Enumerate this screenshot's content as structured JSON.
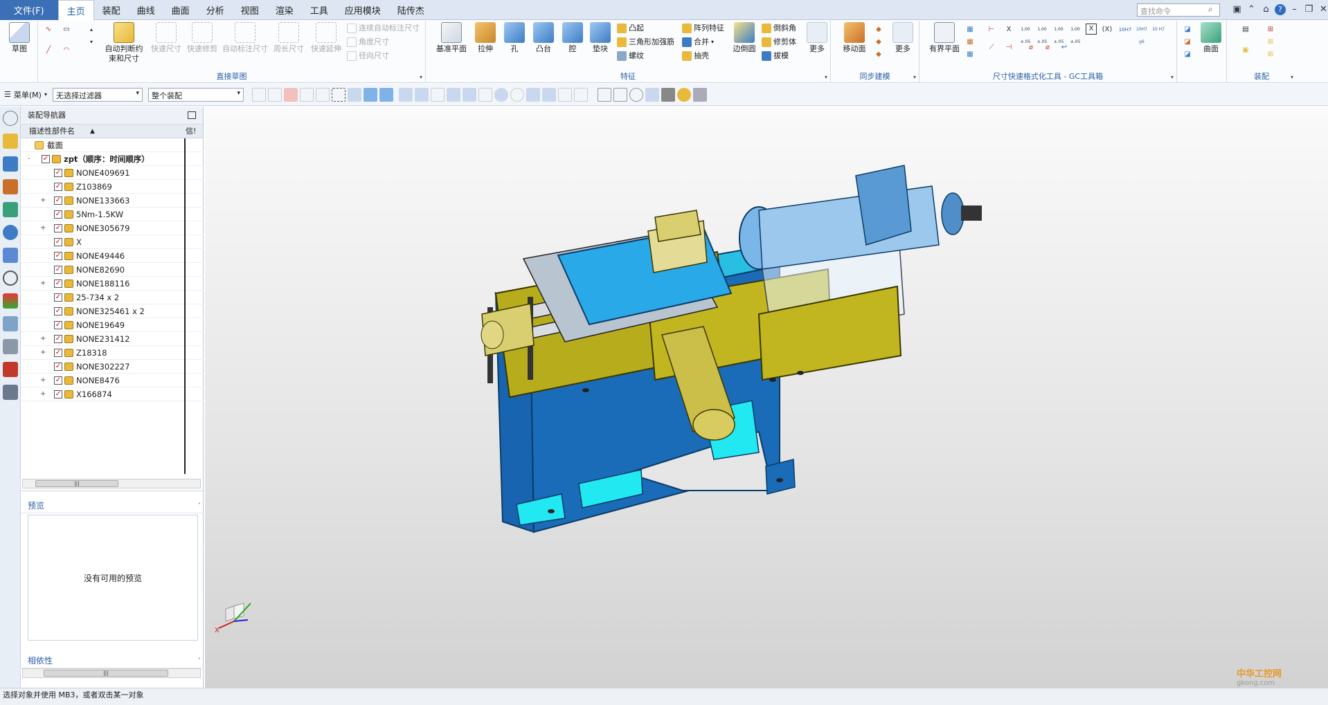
{
  "tabs": {
    "file": "文件(F)",
    "items": [
      "主页",
      "装配",
      "曲线",
      "曲面",
      "分析",
      "视图",
      "渲染",
      "工具",
      "应用模块",
      "陆传杰"
    ]
  },
  "search_placeholder": "查找命令",
  "ribbon": {
    "sketch": {
      "label": "草图"
    },
    "direct_sketch": {
      "group_label": "直接草图",
      "auto_constraint": "自动判断约束和尺寸",
      "quick_dim": "快速尺寸",
      "quick_trim": "快速修剪",
      "auto_dim": "自动标注尺寸",
      "perimeter_dim": "周长尺寸",
      "quick_extend": "快速延伸",
      "cont_auto_dim": "连续自动标注尺寸",
      "angle_dim": "角度尺寸",
      "radial_dim": "径向尺寸"
    },
    "feature": {
      "group_label": "特征",
      "datum_plane": "基准平面",
      "extrude": "拉伸",
      "hole": "孔",
      "boss": "凸台",
      "pocket": "腔",
      "pad": "垫块",
      "emboss": "凸起",
      "tri_rib": "三角形加强筋",
      "thread": "螺纹",
      "pattern": "阵列特征",
      "unite": "合并",
      "shell": "抽壳",
      "edge_blend": "边倒圆",
      "chamfer": "倒斜角",
      "trim_body": "修剪体",
      "draft": "拔模",
      "more": "更多"
    },
    "sync": {
      "group_label": "同步建模",
      "move_face": "移动面",
      "more": "更多"
    },
    "gc": {
      "group_label": "尺寸快速格式化工具 - GC工具箱",
      "bounded_plane": "有界平面",
      "x_label": "X",
      "x_paren": "(X)",
      "fmt_1": "1.00 ±.05",
      "fmt_2": "1.00 ±.05",
      "fmt_3": "1.00 ±.05",
      "fmt_4": "1.00 ±.05",
      "fit_1": "10H7",
      "fit_2": "10H7 g6",
      "fit_3": "10 H7"
    },
    "surface": {
      "label": "曲面"
    },
    "assembly": {
      "group_label": "装配"
    }
  },
  "toolbar": {
    "menu": "菜单(M)",
    "filter": "无选择过滤器",
    "scope": "整个装配"
  },
  "navigator": {
    "title": "装配导航器",
    "col_name": "描述性部件名",
    "col_info": "信!",
    "rows": [
      {
        "label": "截面",
        "type": "folder"
      },
      {
        "label": "zpt（顺序：时间顺序）",
        "type": "root",
        "expand": "-"
      },
      {
        "label": "NONE409691",
        "expand": ""
      },
      {
        "label": "Z103869",
        "expand": ""
      },
      {
        "label": "NONE133663",
        "expand": "+"
      },
      {
        "label": "5Nm-1.5KW",
        "expand": ""
      },
      {
        "label": "NONE305679",
        "expand": "+"
      },
      {
        "label": "X",
        "expand": ""
      },
      {
        "label": "NONE49446",
        "expand": ""
      },
      {
        "label": "NONE82690",
        "expand": ""
      },
      {
        "label": "NONE188116",
        "expand": "+"
      },
      {
        "label": "25-734 x 2",
        "expand": ""
      },
      {
        "label": "NONE325461 x 2",
        "expand": ""
      },
      {
        "label": "NONE19649",
        "expand": ""
      },
      {
        "label": "NONE231412",
        "expand": "+"
      },
      {
        "label": "Z18318",
        "expand": "+"
      },
      {
        "label": "NONE302227",
        "expand": ""
      },
      {
        "label": "NONE8476",
        "expand": "+"
      },
      {
        "label": "X166874",
        "expand": "+"
      }
    ],
    "preview_title": "预览",
    "no_preview": "没有可用的预览",
    "dependency_title": "相依性"
  },
  "triad": {
    "x": "X"
  },
  "status": "选择对象并使用 MB3，或者双击某一对象",
  "watermark": {
    "main": "中华工控网",
    "sub": "gkong.com"
  },
  "colors": {
    "accent": "#3b6fb6",
    "label_blue": "#2b5ea7",
    "machine_base": "#1a6bb8",
    "machine_cyan": "#22c9e8",
    "machine_olive": "#b7ad1c"
  }
}
